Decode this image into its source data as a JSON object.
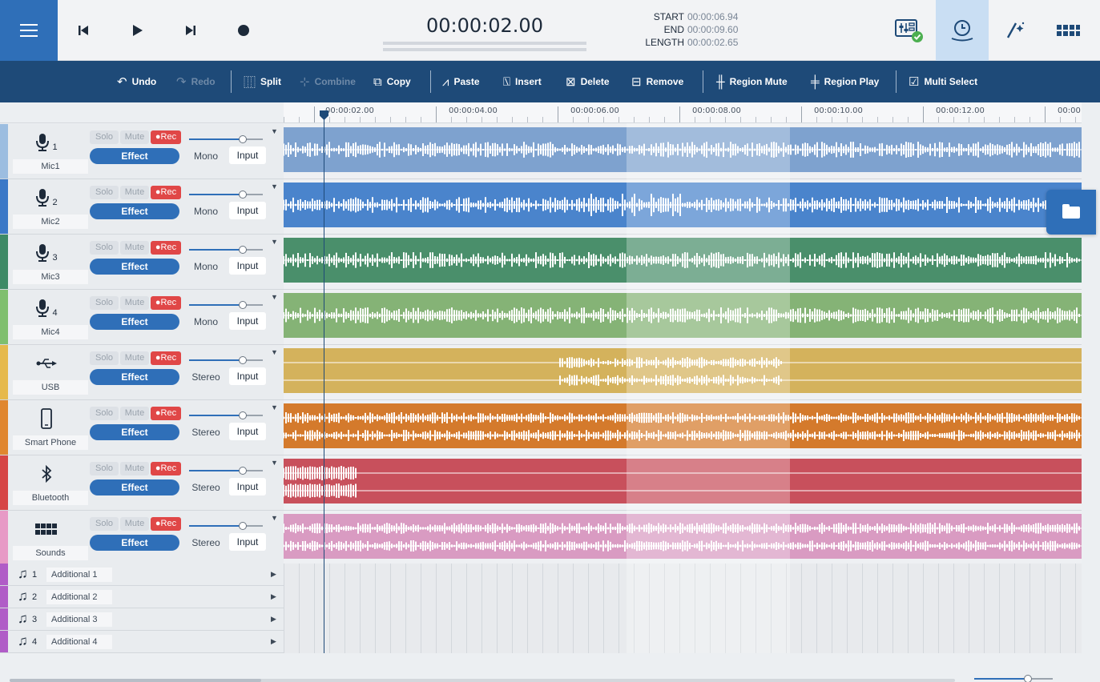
{
  "transport": {
    "timecode": "00:00:02.00",
    "region": {
      "start_label": "START",
      "start_value": "00:00:06.94",
      "end_label": "END",
      "end_value": "00:00:09.60",
      "length_label": "LENGTH",
      "length_value": "00:00:02.65"
    },
    "icons": [
      "menu-icon",
      "skip-back-icon",
      "play-icon",
      "skip-forward-icon",
      "record-icon",
      "mixer-icon",
      "timeline-icon",
      "magic-wand-icon",
      "pads-grid-icon"
    ]
  },
  "toolbar": {
    "undo": "Undo",
    "redo": "Redo",
    "split": "Split",
    "combine": "Combine",
    "copy": "Copy",
    "paste": "Paste",
    "insert": "Insert",
    "delete": "Delete",
    "remove": "Remove",
    "region_mute": "Region Mute",
    "region_play": "Region Play",
    "multi_select": "Multi Select"
  },
  "ruler": {
    "labels": [
      "00:00:02.00",
      "00:00:04.00",
      "00:00:06.00",
      "00:00:08.00",
      "00:00:10.00",
      "00:00:12.00",
      "00:00"
    ]
  },
  "tracks": [
    {
      "name": "Mic1",
      "num": "1",
      "icon": "microphone-icon",
      "mode": "Mono",
      "color": "#9cbde0",
      "wave": "#7ea2cf"
    },
    {
      "name": "Mic2",
      "num": "2",
      "icon": "microphone-icon",
      "mode": "Mono",
      "color": "#3a78c7",
      "wave": "#4a84cc"
    },
    {
      "name": "Mic3",
      "num": "3",
      "icon": "microphone-icon",
      "mode": "Mono",
      "color": "#3e8a66",
      "wave": "#4a8f6b"
    },
    {
      "name": "Mic4",
      "num": "4",
      "icon": "microphone-icon",
      "mode": "Mono",
      "color": "#7fbf6e",
      "wave": "#85b376"
    },
    {
      "name": "USB",
      "num": "",
      "icon": "usb-icon",
      "mode": "Stereo",
      "color": "#e6b94c",
      "wave": "#d4b25c"
    },
    {
      "name": "Smart Phone",
      "num": "",
      "icon": "smartphone-icon",
      "mode": "Stereo",
      "color": "#e0862f",
      "wave": "#d47a2c"
    },
    {
      "name": "Bluetooth",
      "num": "",
      "icon": "bluetooth-icon",
      "mode": "Stereo",
      "color": "#d64545",
      "wave": "#c8505c"
    },
    {
      "name": "Sounds",
      "num": "",
      "icon": "pads-icon",
      "mode": "Stereo",
      "color": "#e79ac6",
      "wave": "#d99bc2"
    }
  ],
  "track_controls": {
    "solo": "Solo",
    "mute": "Mute",
    "rec": "●Rec",
    "effect": "Effect",
    "input": "Input"
  },
  "additional": [
    {
      "num": "1",
      "label": "Additional 1"
    },
    {
      "num": "2",
      "label": "Additional 2"
    },
    {
      "num": "3",
      "label": "Additional 3"
    },
    {
      "num": "4",
      "label": "Additional 4"
    }
  ]
}
